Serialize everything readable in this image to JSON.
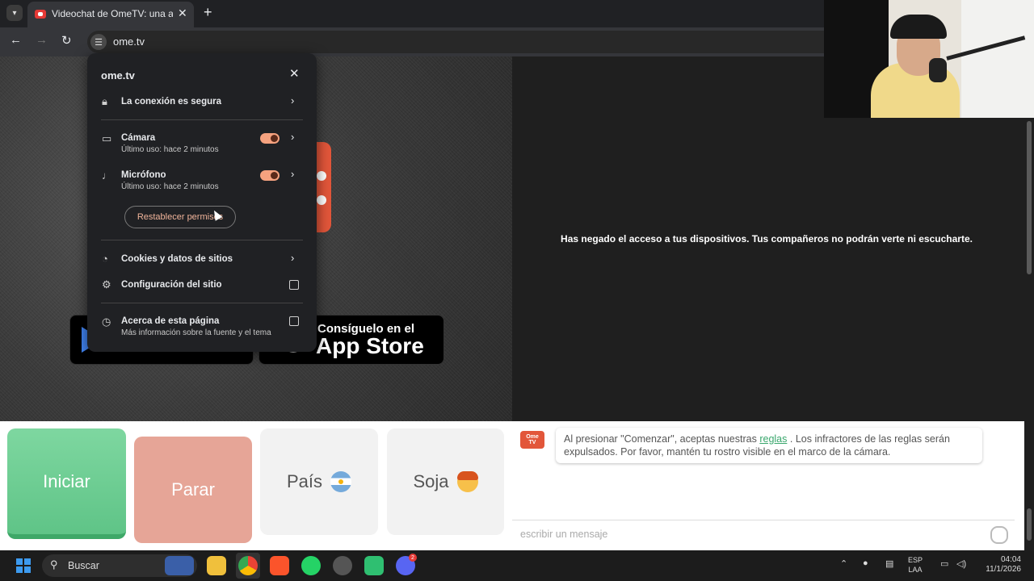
{
  "browser": {
    "tab_title": "Videochat de OmeTV: una alter",
    "tab_close": "✕",
    "new_tab": "+",
    "url": "ome.tv",
    "nav": {
      "back": "←",
      "forward": "→",
      "reload": "↻"
    }
  },
  "site_info": {
    "title": "ome.tv",
    "close": "✕",
    "connection": "La conexión es segura",
    "camera": {
      "label": "Cámara",
      "sub": "Último uso: hace 2 minutos",
      "enabled": true
    },
    "microphone": {
      "label": "Micrófono",
      "sub": "Último uso: hace 2 minutos",
      "enabled": true
    },
    "reset_button": "Restablecer permisos",
    "cookies": "Cookies y datos de sitios",
    "site_settings": "Configuración del sitio",
    "about": {
      "label": "Acerca de esta página",
      "sub": "Más información sobre la fuente y el tema"
    },
    "arrow": "›"
  },
  "stores": {
    "apple_small": "Consíguelo en el",
    "apple_big": "App Store"
  },
  "partner": {
    "denied_message": "Has negado el acceso a tus dispositivos. Tus compañeros no podrán verte ni escucharte."
  },
  "controls": {
    "start": "Iniciar",
    "stop": "Parar",
    "country": "País",
    "gender": "Soja"
  },
  "chat": {
    "logo_line1": "Ome",
    "logo_line2": "TV",
    "message_before": "Al presionar \"Comenzar\", aceptas nuestras",
    "message_link": "reglas",
    "message_after": ". Los infractores de las reglas serán expulsados. Por favor, mantén tu rostro visible en el marco de la cámara.",
    "placeholder": "escribir un mensaje"
  },
  "taskbar": {
    "search": "Buscar",
    "lang_top": "ESP",
    "lang_bottom": "LAA",
    "time": "04:04",
    "date": "11/1/2026",
    "discord_badge": "2"
  },
  "colors": {
    "accent_orange": "#e2563a",
    "start_green": "#5fc487",
    "stop_salmon": "#e6a597",
    "toggle_on": "#f5a27f"
  }
}
